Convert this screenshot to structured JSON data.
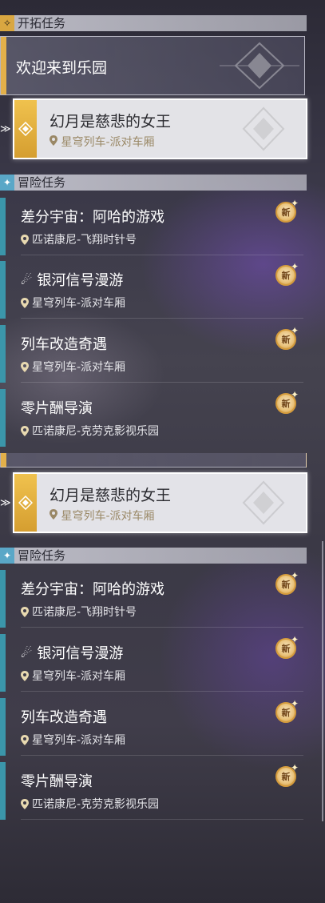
{
  "trailblaze": {
    "header": "开拓任务",
    "main_quest": "欢迎来到乐园",
    "selected_quest": {
      "title": "幻月是慈悲的女王",
      "location": "星穹列车-派对车厢"
    }
  },
  "adventure": {
    "header": "冒险任务",
    "quests": [
      {
        "title": "差分宇宙：阿哈的游戏",
        "location": "匹诺康尼-飞翔时针号",
        "badge": "新"
      },
      {
        "title": "银河信号漫游",
        "location": "星穹列车-派对车厢",
        "badge": "新"
      },
      {
        "title": "列车改造奇遇",
        "location": "星穹列车-派对车厢",
        "badge": "新"
      },
      {
        "title": "零片酬导演",
        "location": "匹诺康尼-克劳克影视乐园",
        "badge": "新"
      }
    ]
  },
  "icons": {
    "trailblaze": "trailblaze-emblem-icon",
    "adventure": "adventure-star-icon",
    "location": "map-pin-icon",
    "new": "new-badge-icon",
    "signal": "signal-wave-icon",
    "selected": "selected-arrow-icon"
  },
  "colors": {
    "gold_accent": "#e3b04a",
    "teal_accent": "#3b96aa",
    "location_text": "#9a8866"
  }
}
